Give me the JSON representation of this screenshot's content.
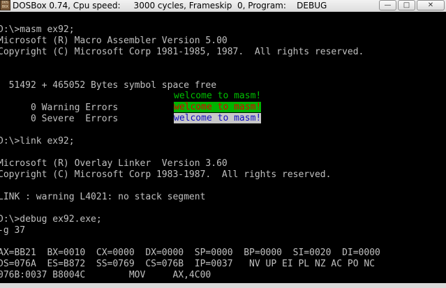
{
  "window": {
    "icon_label_top": "DOS",
    "icon_label_bottom": "BOX",
    "title": "DOSBox 0.74, Cpu speed:     3000 cycles, Frameskip  0, Program:    DEBUG",
    "minimize_glyph": "—",
    "maximize_glyph": "□",
    "close_glyph": "✕"
  },
  "terminal": {
    "lines": [
      "D:\\>masm ex92;",
      "Microsoft (R) Macro Assembler Version 5.00",
      "Copyright (C) Microsoft Corp 1981-1985, 1987.  All rights reserved.",
      "",
      "",
      "  51492 + 465052 Bytes symbol space free",
      "",
      "      0 Warning Errors",
      "      0 Severe  Errors",
      "",
      "D:\\>link ex92;",
      "",
      "Microsoft (R) Overlay Linker  Version 3.60",
      "Copyright (C) Microsoft Corp 1983-1987.  All rights reserved.",
      "",
      "LINK : warning L4021: no stack segment",
      "",
      "D:\\>debug ex92.exe;",
      "-g 37",
      "",
      "AX=BB21  BX=0010  CX=0000  DX=0000  SP=0000  BP=0000  SI=0020  DI=0000",
      "DS=076A  ES=B872  SS=0769  CS=076B  IP=0037   NV UP EI PL NZ AC PO NC",
      "076B:0037 B8004C        MOV     AX,4C00"
    ],
    "welcome_messages": [
      "welcome to masm!",
      "welcome to masm!",
      "welcome to masm!"
    ],
    "colors": {
      "text": "#c0c0c0",
      "background": "#000000",
      "welcome_green": "#00c000",
      "welcome_red_on_green_fg": "#e00000",
      "welcome_red_on_green_bg": "#00b400",
      "welcome_blue_on_white_fg": "#1010c0",
      "welcome_blue_on_white_bg": "#c8c8c8"
    }
  }
}
